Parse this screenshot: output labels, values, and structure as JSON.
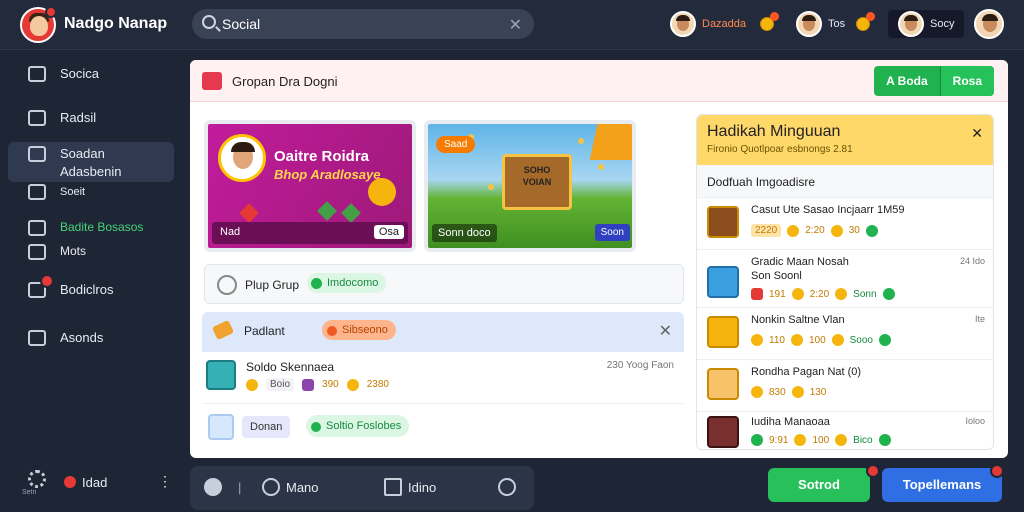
{
  "app": {
    "title": "Nadgo Nanap"
  },
  "search": {
    "value": "Social"
  },
  "topbar": {
    "user1": {
      "name": "Dazadda"
    },
    "user2": {
      "name": "Tos"
    },
    "user3": {
      "name": "Socy"
    }
  },
  "sidebar": {
    "items": [
      {
        "label": "Socica",
        "icon": "home-icon"
      },
      {
        "label": "Radsil",
        "icon": "thumbs-up-icon"
      },
      {
        "label": "Soadan",
        "label2": "Adasbenin",
        "icon": "chat-icon"
      },
      {
        "label": "Soeit",
        "icon": "grid-icon"
      },
      {
        "label": "Badite Bosasos",
        "icon": "link-icon"
      },
      {
        "label": "Mots",
        "icon": "heart-icon"
      },
      {
        "label": "Bodiclros",
        "icon": "document-icon"
      },
      {
        "label": "Asonds",
        "icon": "key-icon"
      }
    ],
    "footer": {
      "settings_label": "Setn",
      "item": "Idad"
    }
  },
  "panel": {
    "title": "Gropan Dra Dogni",
    "buttons": [
      "A Boda",
      "Rosa"
    ]
  },
  "banner1": {
    "title": "Oaitre Roidra",
    "subtitle": "Bhop Aradlosaye",
    "bar_left": "Nad",
    "bar_right": "Osa"
  },
  "banner2": {
    "tag": "Saad",
    "chest_line1": "SOHO",
    "chest_line2": "VOIAN",
    "bar_left": "Sonn doco",
    "bar_right": "Soon"
  },
  "group_row": {
    "label": "Plup Grup",
    "pill": "Imdocomo"
  },
  "notification": {
    "title": "Padlant",
    "pill": "Sibseono"
  },
  "feed1": {
    "name": "Soldo Skennaea",
    "time": "230 Yoog Faon",
    "stats": [
      "Boio",
      "390",
      "2380"
    ]
  },
  "feed2": {
    "tag": "Donan",
    "pill": "Soltio Foslobes"
  },
  "right_panel": {
    "title": "Hadikah Minguuan",
    "subtitle": "Fironio Quotlpoar esbnongs 2.81",
    "section": "Dodfuah Imgoadisre",
    "rows": [
      {
        "name": "Casut Ute Sasao Incjaarr 1M59",
        "time": "",
        "line2": "",
        "stats": [
          "2220",
          "2:20",
          "30"
        ]
      },
      {
        "name": "Gradic Maan Nosah",
        "time": "24 Ido",
        "line2": "Son Soonl",
        "stats": [
          "191",
          "2:20",
          "Sonn"
        ]
      },
      {
        "name": "Nonkin Saltne Vlan",
        "time": "Ite",
        "line2": "",
        "stats": [
          "110",
          "100",
          "Sooo"
        ]
      },
      {
        "name": "Rondha Pagan Nat (0)",
        "time": "",
        "line2": "",
        "stats": [
          "830",
          "130"
        ]
      },
      {
        "name": "Iudiha Manaoaa",
        "time": "Ioloo",
        "line2": "",
        "stats": [
          "9:91",
          "100",
          "Bico"
        ]
      }
    ]
  },
  "bottom_bar": {
    "sep": "|",
    "item1": "Mano",
    "item2": "Idino"
  },
  "actions": {
    "primary": "Sotrod",
    "secondary": "Topellemans"
  }
}
